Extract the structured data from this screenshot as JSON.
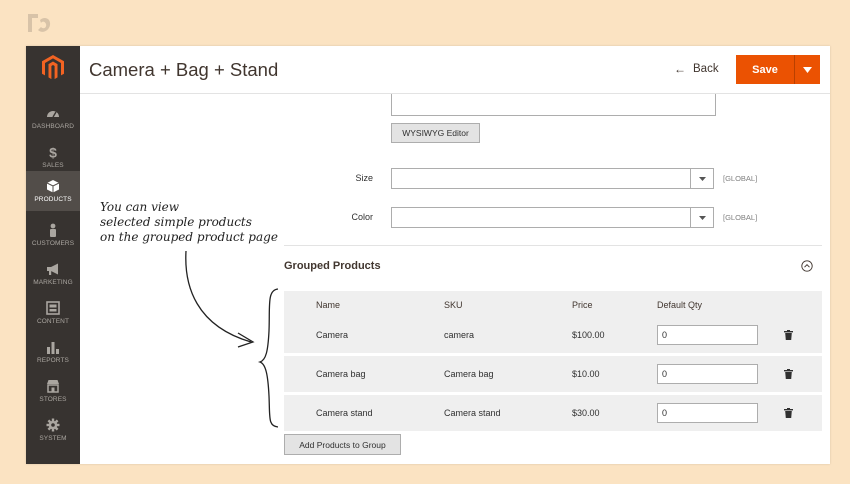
{
  "header": {
    "title": "Camera + Bag + Stand",
    "back_label": "Back",
    "save_label": "Save"
  },
  "sidebar": {
    "items": [
      {
        "label": "DASHBOARD",
        "icon": "dashboard-icon"
      },
      {
        "label": "SALES",
        "icon": "dollar-icon"
      },
      {
        "label": "PRODUCTS",
        "icon": "cube-icon",
        "active": true
      },
      {
        "label": "CUSTOMERS",
        "icon": "person-icon"
      },
      {
        "label": "MARKETING",
        "icon": "megaphone-icon"
      },
      {
        "label": "CONTENT",
        "icon": "content-icon"
      },
      {
        "label": "REPORTS",
        "icon": "bar-chart-icon"
      },
      {
        "label": "STORES",
        "icon": "store-icon"
      },
      {
        "label": "SYSTEM",
        "icon": "gear-icon"
      }
    ]
  },
  "form": {
    "wysiwyg_label": "WYSIWYG Editor",
    "size_label": "Size",
    "color_label": "Color",
    "scope_label": "[GLOBAL]"
  },
  "annotation": {
    "line1": "You can view",
    "line2": "selected simple products",
    "line3": "on the grouped product page"
  },
  "grouped": {
    "title": "Grouped Products",
    "columns": [
      "Name",
      "SKU",
      "Price",
      "Default Qty"
    ],
    "rows": [
      {
        "name": "Camera",
        "sku": "camera",
        "price": "$100.00",
        "qty": "0"
      },
      {
        "name": "Camera bag",
        "sku": "Camera bag",
        "price": "$10.00",
        "qty": "0"
      },
      {
        "name": "Camera stand",
        "sku": "Camera stand",
        "price": "$30.00",
        "qty": "0"
      }
    ],
    "add_label": "Add Products to Group"
  },
  "colors": {
    "accent": "#eb5202",
    "sidebar": "#373330",
    "background": "#fbe3c2"
  }
}
